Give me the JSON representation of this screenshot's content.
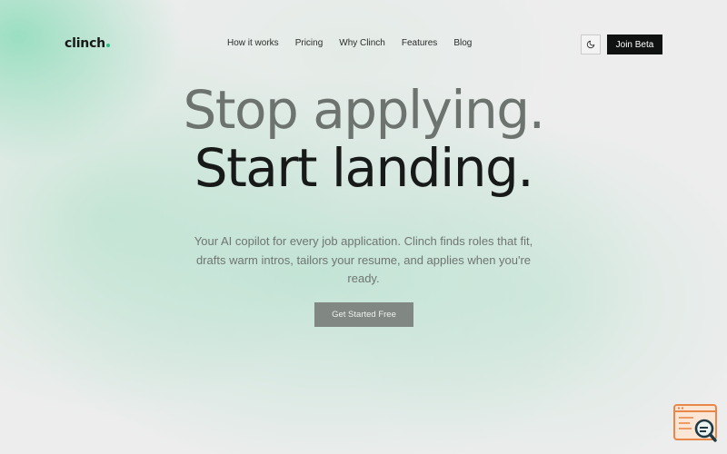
{
  "brand": {
    "name": "clinch",
    "accent": "#2dbf7f"
  },
  "nav": {
    "links": [
      {
        "label": "How it works"
      },
      {
        "label": "Pricing"
      },
      {
        "label": "Why Clinch"
      },
      {
        "label": "Features"
      },
      {
        "label": "Blog"
      }
    ],
    "theme_toggle_icon": "moon-icon",
    "join_label": "Join Beta"
  },
  "hero": {
    "headline_line1": "Stop applying.",
    "headline_line2": "Start landing.",
    "subtitle": "Your AI copilot for every job application. Clinch finds roles that fit, drafts warm intros, tailors your resume, and applies when you're ready.",
    "cta_label": "Get Started Free"
  },
  "widget": {
    "icon": "search-badge-icon"
  },
  "colors": {
    "background": "#ededed",
    "mint": "#8cdcb9",
    "button_dark": "#101211",
    "cta_gray": "#818783"
  }
}
